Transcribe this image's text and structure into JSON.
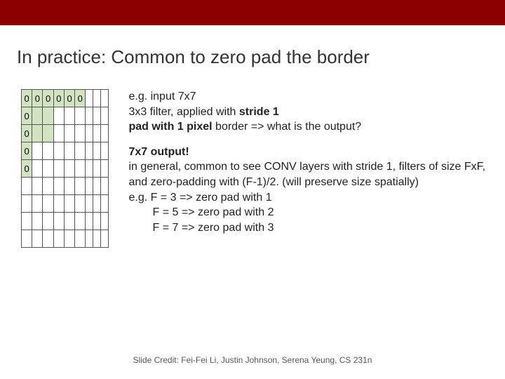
{
  "title": "In practice: Common to zero pad the border",
  "grid": {
    "rows": 9,
    "cols": 9,
    "pad_value": "0",
    "pad_cells": [
      [
        0,
        0
      ],
      [
        0,
        1
      ],
      [
        0,
        2
      ],
      [
        0,
        3
      ],
      [
        0,
        4
      ],
      [
        0,
        5
      ],
      [
        1,
        0
      ],
      [
        1,
        1
      ],
      [
        1,
        2
      ],
      [
        2,
        0
      ],
      [
        2,
        1
      ],
      [
        2,
        2
      ],
      [
        3,
        0
      ],
      [
        4,
        0
      ]
    ],
    "labeled_cells": [
      [
        0,
        0
      ],
      [
        0,
        1
      ],
      [
        0,
        2
      ],
      [
        0,
        3
      ],
      [
        0,
        4
      ],
      [
        0,
        5
      ],
      [
        1,
        0
      ],
      [
        2,
        0
      ],
      [
        3,
        0
      ],
      [
        4,
        0
      ]
    ]
  },
  "para1": {
    "l1a": "e.g. input 7x7",
    "l2a": "3x3 filter, applied with ",
    "l2b": "stride 1",
    "l3a": "pad with 1 pixel",
    "l3b": " border => what is the output?"
  },
  "para2": {
    "l1": "7x7 output!",
    "l2": "in general, common to see CONV layers with stride 1, filters of size FxF, and zero-padding with (F-1)/2. (will preserve size spatially)",
    "l3": "e.g. F = 3 => zero pad with 1",
    "l4": "F = 5 => zero pad with 2",
    "l5": "F = 7 => zero pad with 3"
  },
  "credit": "Slide Credit: Fei-Fei Li, Justin Johnson, Serena Yeung, CS 231n"
}
